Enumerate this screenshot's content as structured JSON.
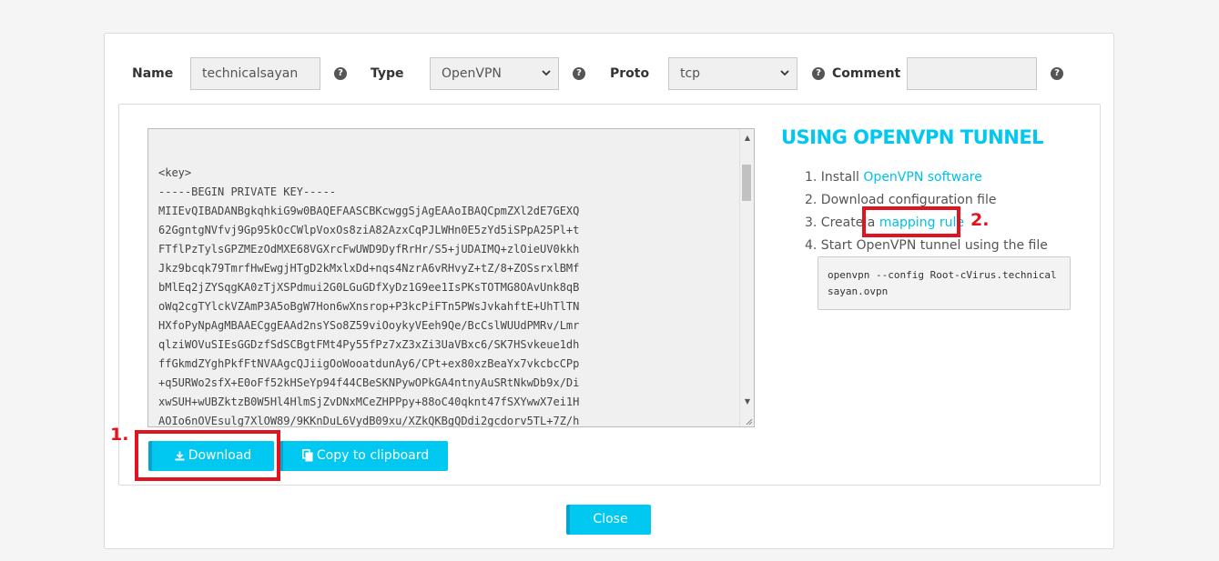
{
  "form": {
    "name_label": "Name",
    "name_value": "technicalsayan",
    "type_label": "Type",
    "type_value": "OpenVPN",
    "proto_label": "Proto",
    "proto_value": "tcp",
    "comment_label": "Comment",
    "comment_value": "",
    "help_glyph": "?"
  },
  "config_text": "<key>\n-----BEGIN PRIVATE KEY-----\nMIIEvQIBADANBgkqhkiG9w0BAQEFAASCBKcwggSjAgEAAoIBAQCpmZXl2dE7GEXQ\n62GgntgNVfvj9Gp95kOcCWlpVoxOs8ziA82AzxCqPJLWHn0E5zYd5iSPpA25Pl+t\nFTflPzTylsGPZMEzOdMXE68VGXrcFwUWD9DyfRrHr/S5+jUDAIMQ+zlOieUV0kkh\nJkz9bcqk79TmrfHwEwgjHTgD2kMxlxDd+nqs4NzrA6vRHvyZ+tZ/8+ZOSsrxlBMf\nbMlEq2jZYSqgKA0zTjXSPdmui2G0LGuGDfXyDz1G9ee1IsPKsTOTMG8OAvUnk8qB\noWq2cgTYlckVZAmP3A5oBgW7Hon6wXnsrop+P3kcPiFTn5PWsJvkahftE+UhTlTN\nHXfoPyNpAgMBAAECggEAAd2nsYSo8Z59viOoykyVEeh9Qe/BcCslWUUdPMRv/Lmr\nqlziWOVuSIEsGGDzfSdSCBgtFMt4Py55fPz7xZ3xZi3UaVBxc6/SK7HSvkeue1dh\nffGkmdZYghPkfFtNVAAgcQJiigOoWooatdunAy6/CPt+ex80xzBeaYx7vkcbcCPp\n+q5URWo2sfX+E0oFf52kHSeYp94f44CBeSKNPywOPkGA4ntnyAuSRtNkwDb9x/Di\nxwSUH+wUBZktzB0W5Hl4HlmSjZvDNxMCeZHPPpy+88oC40qknt47fSXYwwX7ei1H\nAOIo6nOVEsulg7XlOW89/9KKnDuL6VydB09xu/XZkQKBgQDdi2gcdorv5TL+7Z/h",
  "download_label": "Download",
  "copy_label": "Copy to clipboard",
  "close_label": "Close",
  "guide": {
    "title": "USING OPENVPN TUNNEL",
    "step1_prefix": "1. Install ",
    "step1_link": "OpenVPN software",
    "step2": "2. Download configuration file",
    "step3_prefix": "3. Create a ",
    "step3_link": "mapping rule",
    "step4": "4. Start OpenVPN tunnel using the file",
    "command": "openvpn --config Root-cVirus.technicalsayan.ovpn"
  },
  "annotations": {
    "marker1": "1.",
    "marker2": "2."
  },
  "colors": {
    "accent": "#00c8f0",
    "marker": "#e0141e"
  }
}
